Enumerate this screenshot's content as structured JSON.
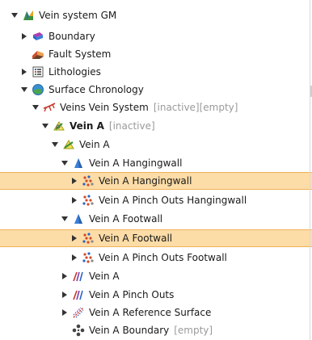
{
  "tree": {
    "items": [
      {
        "label": "Vein system GM",
        "toggle": "expanded",
        "icon": "geomodel-icon",
        "depth": 0
      },
      {
        "label": "Boundary",
        "toggle": "collapsed",
        "icon": "boundary-icon",
        "depth": 1
      },
      {
        "label": "Fault System",
        "toggle": "none",
        "icon": "fault-system-icon",
        "depth": 1
      },
      {
        "label": "Lithologies",
        "toggle": "collapsed",
        "icon": "lithologies-icon",
        "depth": 1
      },
      {
        "label": "Surface Chronology",
        "toggle": "expanded",
        "icon": "surface-chronology-icon",
        "depth": 1
      },
      {
        "label": "Veins Vein System",
        "meta": "[inactive][empty]",
        "toggle": "expanded",
        "icon": "vein-system-icon",
        "depth": 2
      },
      {
        "label": "Vein A",
        "meta": "[inactive]",
        "bold": true,
        "toggle": "expanded",
        "icon": "vein-inactive-icon",
        "depth": 3
      },
      {
        "label": "Vein A",
        "toggle": "expanded",
        "icon": "vein-icon",
        "depth": 4
      },
      {
        "label": "Vein A Hangingwall",
        "toggle": "expanded",
        "icon": "hangingwall-surface-icon",
        "depth": 5
      },
      {
        "label": "Vein A Hangingwall",
        "toggle": "collapsed",
        "icon": "point-data-icon",
        "depth": 6,
        "selected": true
      },
      {
        "label": "Vein A Pinch Outs Hangingwall",
        "toggle": "collapsed",
        "icon": "point-data-icon",
        "depth": 6
      },
      {
        "label": "Vein A Footwall",
        "toggle": "expanded",
        "icon": "footwall-surface-icon",
        "depth": 5
      },
      {
        "label": "Vein A Footwall",
        "toggle": "collapsed",
        "icon": "point-data-icon",
        "depth": 6,
        "selected": true
      },
      {
        "label": "Vein A Pinch Outs Footwall",
        "toggle": "collapsed",
        "icon": "point-data-icon",
        "depth": 6
      },
      {
        "label": "Vein A",
        "toggle": "collapsed",
        "icon": "vein-lines-icon",
        "depth": 5
      },
      {
        "label": "Vein A Pinch Outs",
        "toggle": "collapsed",
        "icon": "vein-lines-icon",
        "depth": 5
      },
      {
        "label": "Vein A Reference Surface",
        "toggle": "collapsed",
        "icon": "reference-surface-icon",
        "depth": 5
      },
      {
        "label": "Vein A Boundary",
        "meta": "[empty]",
        "toggle": "none",
        "icon": "boundary-points-icon",
        "depth": 5
      }
    ]
  },
  "colors": {
    "selection_bg": "#fcdca7",
    "selection_border": "#f0b25a",
    "meta_text": "#9a9a9a"
  }
}
